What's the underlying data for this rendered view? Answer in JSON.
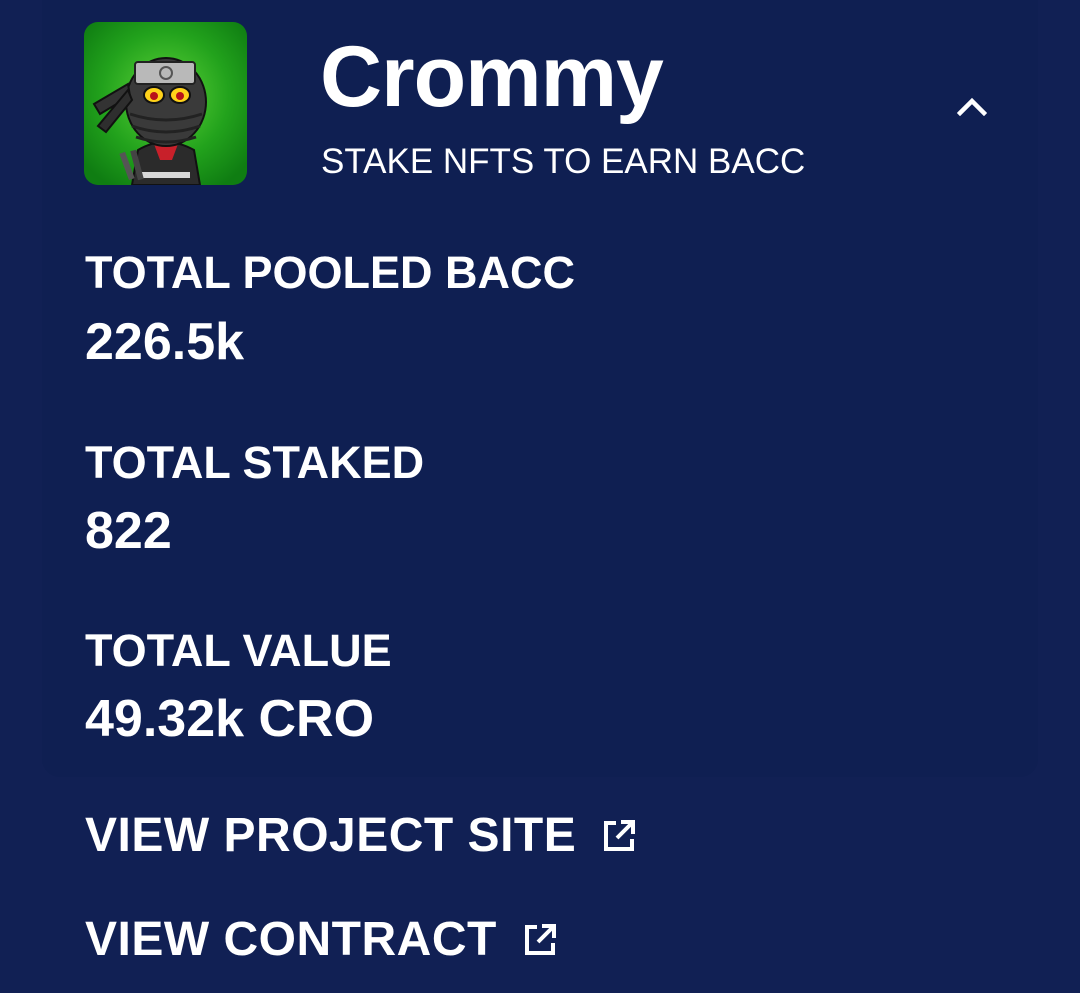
{
  "pool": {
    "name": "Crommy",
    "subtitle": "STAKE NFTS TO EARN BACC",
    "avatar_icon": "ninja-cat-nft-avatar",
    "collapse_icon": "chevron-up-icon"
  },
  "stats": [
    {
      "label": "TOTAL POOLED BACC",
      "value": "226.5k"
    },
    {
      "label": "TOTAL STAKED",
      "value": "822"
    },
    {
      "label": "TOTAL VALUE",
      "value": "49.32k CRO"
    }
  ],
  "links": [
    {
      "label": "VIEW PROJECT SITE",
      "icon": "external-link-icon"
    },
    {
      "label": "VIEW CONTRACT",
      "icon": "external-link-icon"
    }
  ],
  "colors": {
    "background": "#112054",
    "panel": "#0f1f52",
    "text": "#ffffff",
    "avatar_bg": "#1aa01a"
  }
}
